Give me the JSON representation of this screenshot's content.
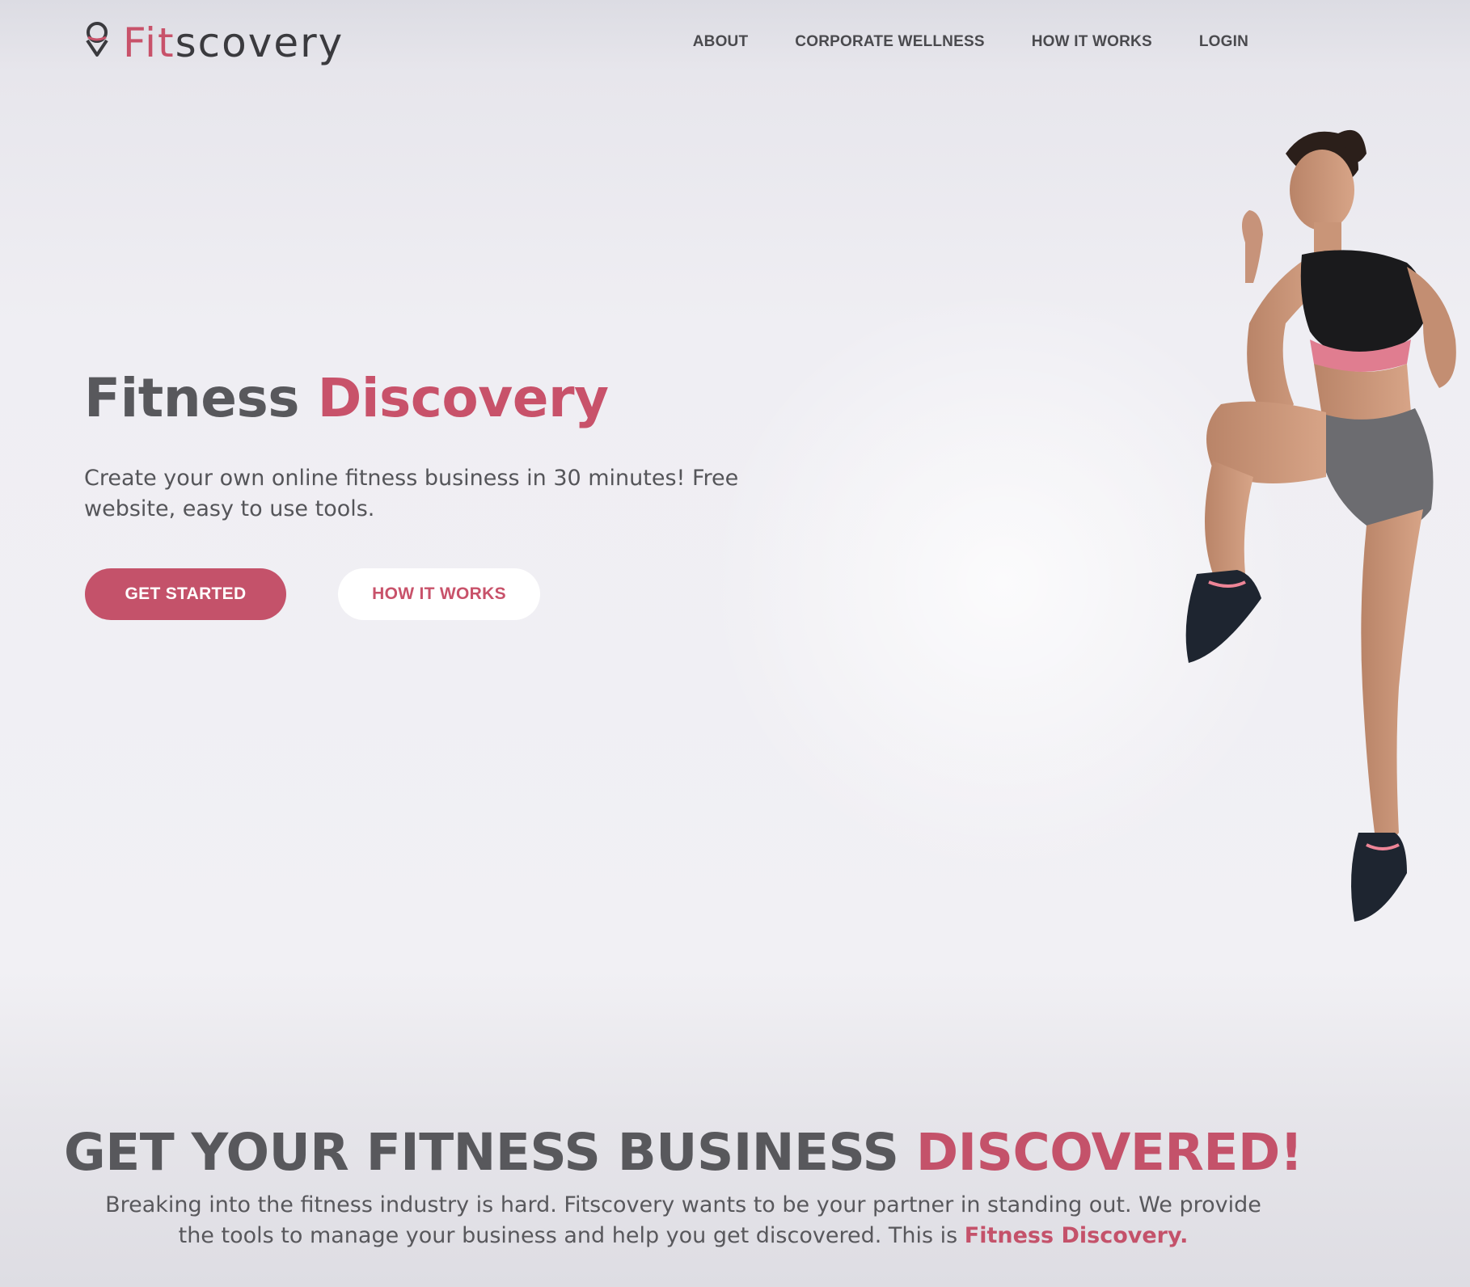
{
  "header": {
    "logo": {
      "text_part1": "Fit",
      "text_part2": "scovery"
    },
    "nav": [
      {
        "label": "ABOUT"
      },
      {
        "label": "CORPORATE WELLNESS"
      },
      {
        "label": "HOW IT WORKS"
      },
      {
        "label": "LOGIN"
      }
    ]
  },
  "hero": {
    "title_part1": "Fitness",
    "title_part2": "Discovery",
    "subtitle": "Create your own online fitness business in 30 minutes! Free website, easy to use tools.",
    "primary_button": "GET STARTED",
    "secondary_button": "HOW IT WORKS"
  },
  "section2": {
    "title_part1": "GET YOUR FITNESS BUSINESS",
    "title_part2": "DISCOVERED!",
    "body": "Breaking into the fitness industry is hard. Fitscovery wants to be your partner in standing out. We provide the tools to manage your business and help you get discovered. This is",
    "body_emphasis": "Fitness Discovery."
  },
  "colors": {
    "accent": "#c4526a",
    "text_dark": "#58585c",
    "background": "#efeef3"
  },
  "icons": {
    "logo_mark": "map-pin-icon"
  }
}
